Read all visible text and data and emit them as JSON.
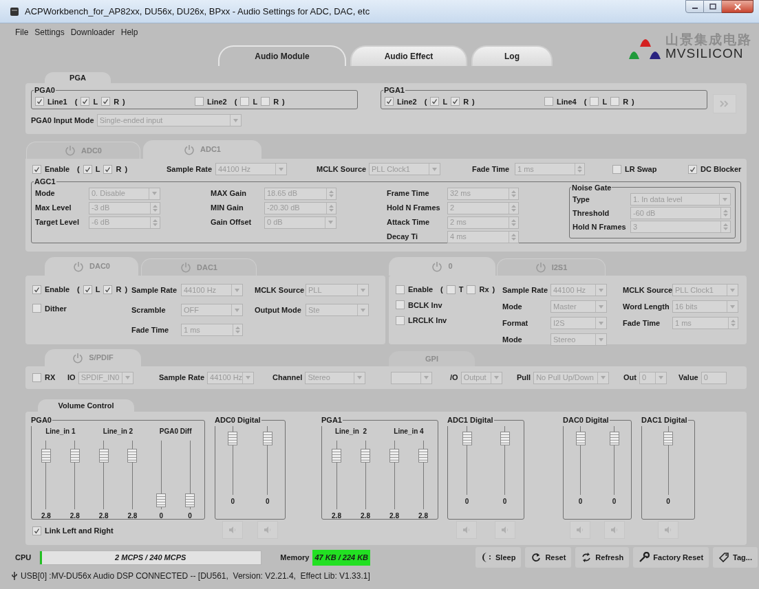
{
  "window": {
    "title": "ACPWorkbench_for_AP82xx, DU56x, DU26x, BPxx - Audio Settings for ADC, DAC, etc"
  },
  "menu": [
    {
      "label": "File"
    },
    {
      "label": "Settings"
    },
    {
      "label": "Downloader"
    },
    {
      "label": "Help"
    }
  ],
  "main_tabs": [
    {
      "label": "Audio Module",
      "selected": true
    },
    {
      "label": "Audio Effect",
      "selected": false
    },
    {
      "label": "Log",
      "selected": false
    }
  ],
  "logo": {
    "name_cn": "山景集成电路",
    "name_en": "MVSILICON"
  },
  "pga": {
    "tab": "PGA",
    "groups": [
      {
        "title": "PGA0",
        "lines": [
          {
            "label": "Line1",
            "checked": true,
            "open": "(",
            "close": ")",
            "channels": [
              {
                "label": "L",
                "checked": true
              },
              {
                "label": "R",
                "checked": true
              }
            ]
          },
          {
            "label": "Line2",
            "checked": false,
            "open": "(",
            "close": ")",
            "channels": [
              {
                "label": "L",
                "checked": false
              },
              {
                "label": "R",
                "checked": false
              }
            ]
          }
        ]
      },
      {
        "title": "PGA1",
        "lines": [
          {
            "label": "Line2",
            "checked": true,
            "open": "(",
            "close": ")",
            "channels": [
              {
                "label": "L",
                "checked": true
              },
              {
                "label": "R",
                "checked": true
              }
            ]
          },
          {
            "label": "Line4",
            "checked": false,
            "open": "(",
            "close": ")",
            "channels": [
              {
                "label": "L",
                "checked": false
              },
              {
                "label": "R",
                "checked": false
              }
            ]
          }
        ]
      }
    ],
    "input_mode": {
      "kind": "combo",
      "label": "PGA0 Input Mode",
      "value": "Single-ended input"
    }
  },
  "adc": {
    "tabs": [
      {
        "label": "ADC0",
        "selected": false
      },
      {
        "label": "ADC1",
        "selected": true
      }
    ],
    "top": [
      {
        "kind": "enable",
        "label": "Enable",
        "checked": true,
        "open": "(",
        "close": ")",
        "channels": [
          {
            "label": "L",
            "checked": true
          },
          {
            "label": "R",
            "checked": true
          }
        ]
      },
      {
        "kind": "combo",
        "label": "Sample Rate",
        "value": "44100 Hz"
      },
      {
        "kind": "combo",
        "label": "MCLK Source",
        "value": "PLL Clock1"
      },
      {
        "kind": "spin",
        "label": "Fade Time",
        "value": "1 ms"
      },
      {
        "kind": "check",
        "label": "LR Swap",
        "checked": false
      },
      {
        "kind": "check",
        "label": "DC Blocker",
        "checked": true
      }
    ],
    "agc": {
      "title": "AGC1",
      "columns": [
        [
          {
            "kind": "combo",
            "label": "Mode",
            "value": "0. Disable"
          },
          {
            "kind": "spin",
            "label": "Max Level",
            "value": "-3 dB"
          },
          {
            "kind": "spin",
            "label": "Target Level",
            "value": "-6 dB"
          }
        ],
        [
          {
            "kind": "spin",
            "label": "MAX Gain",
            "value": "18.65 dB"
          },
          {
            "kind": "spin",
            "label": "MIN Gain",
            "value": "-20.30 dB"
          },
          {
            "kind": "combo",
            "label": "Gain Offset",
            "value": "0 dB"
          }
        ],
        [
          {
            "kind": "spin",
            "label": "Frame Time",
            "value": "32 ms"
          },
          {
            "kind": "spin",
            "label": "Hold N Frames",
            "value": "2"
          },
          {
            "kind": "spin",
            "label": "Attack Time",
            "value": "2 ms"
          },
          {
            "kind": "spin",
            "label": "Decay Ti",
            "value": "4 ms"
          }
        ]
      ],
      "noise_gate": {
        "title": "Noise Gate",
        "fields": [
          {
            "kind": "combo",
            "label": "Type",
            "value": "1. In data level"
          },
          {
            "kind": "spin",
            "label": "Threshold",
            "value": "-60 dB"
          },
          {
            "kind": "spin",
            "label": "Hold N Frames",
            "value": "3"
          }
        ]
      }
    }
  },
  "dac": {
    "tabs": [
      {
        "label": "DAC0",
        "selected": true
      },
      {
        "label": "DAC1",
        "selected": false
      }
    ],
    "columns": [
      [
        {
          "kind": "enable",
          "label": "Enable",
          "checked": true,
          "open": "(",
          "close": ")",
          "channels": [
            {
              "label": "L",
              "checked": true
            },
            {
              "label": "R",
              "checked": true
            }
          ]
        },
        {
          "kind": "check",
          "label": "Dither",
          "checked": false
        }
      ],
      [
        {
          "kind": "combo",
          "label": "Sample Rate",
          "value": "44100 Hz"
        },
        {
          "kind": "combo",
          "label": "Scramble",
          "value": "OFF"
        },
        {
          "kind": "spin",
          "label": "Fade Time",
          "value": "1 ms"
        }
      ],
      [
        {
          "kind": "combo",
          "label": "MCLK Source",
          "value": "PLL"
        },
        {
          "kind": "combo",
          "label": "Output Mode",
          "value": "Ste"
        }
      ]
    ]
  },
  "i2s": {
    "tabs": [
      {
        "label": "0",
        "selected": true
      },
      {
        "label": "I2S1",
        "selected": false
      }
    ],
    "columns": [
      [
        {
          "kind": "enable",
          "label": "Enable",
          "checked": false,
          "open": "(",
          "close": ")",
          "channels": [
            {
              "label": "T",
              "checked": false
            },
            {
              "label": "Rx",
              "checked": false
            }
          ]
        },
        {
          "kind": "check",
          "label": "BCLK Inv",
          "checked": false
        },
        {
          "kind": "check",
          "label": "LRCLK Inv",
          "checked": false
        }
      ],
      [
        {
          "kind": "combo",
          "label": "Sample Rate",
          "value": "44100 Hz"
        },
        {
          "kind": "combo",
          "label": "Mode",
          "value": "Master"
        },
        {
          "kind": "combo",
          "label": "Format",
          "value": "I2S"
        },
        {
          "kind": "combo",
          "label": "Mode",
          "value": "Stereo"
        }
      ],
      [
        {
          "kind": "combo",
          "label": "MCLK Source",
          "value": "PLL Clock1"
        },
        {
          "kind": "combo",
          "label": "Word Length",
          "value": "16 bits"
        },
        {
          "kind": "spin",
          "label": "Fade Time",
          "value": "1 ms"
        }
      ]
    ]
  },
  "spdif": {
    "tabs": [
      {
        "label": "S/PDIF",
        "selected": true
      }
    ],
    "gpio_tab": {
      "label": "GPI"
    },
    "items": [
      {
        "kind": "check",
        "label": "RX",
        "checked": false
      },
      {
        "kind": "combo",
        "label": "IO",
        "value": "SPDIF_IN0"
      },
      {
        "kind": "combo",
        "label": "Sample Rate",
        "value": "44100 Hz"
      },
      {
        "kind": "combo",
        "label": "Channel",
        "value": "Stereo"
      },
      {
        "kind": "combo"
      },
      {
        "kind": "combo",
        "label": "/O",
        "value": "Output"
      },
      {
        "kind": "combo",
        "label": "Pull",
        "value": "No Pull Up/Down"
      },
      {
        "kind": "combo",
        "label": "Out",
        "value": "0"
      },
      {
        "kind": "text",
        "label": "Value",
        "value": "0"
      }
    ]
  },
  "volume": {
    "tab": "Volume Control",
    "groups": [
      {
        "title": "PGA0",
        "mute_buttons": false,
        "channels": [
          {
            "label": "Line_in 1",
            "sliders": [
              {
                "level": 0.85,
                "value": "2.8"
              },
              {
                "level": 0.85,
                "value": "2.8"
              }
            ]
          },
          {
            "label": "Line_in 2",
            "sliders": [
              {
                "level": 0.85,
                "value": "2.8"
              },
              {
                "level": 0.85,
                "value": "2.8"
              }
            ]
          },
          {
            "label": "PGA0 Diff",
            "sliders": [
              {
                "level": 0.03,
                "value": "0"
              },
              {
                "level": 0.03,
                "value": "0"
              }
            ]
          }
        ]
      },
      {
        "title": "ADC0 Digital",
        "mute_buttons": true,
        "channels": [
          {
            "sliders": [
              {
                "level": 0.9,
                "value": "0"
              },
              {
                "level": 0.9,
                "value": "0"
              }
            ]
          }
        ]
      },
      {
        "title": "PGA1",
        "mute_buttons": false,
        "channels": [
          {
            "label": "Line_in  2",
            "sliders": [
              {
                "level": 0.85,
                "value": "2.8"
              },
              {
                "level": 0.85,
                "value": "2.8"
              }
            ]
          },
          {
            "label": "Line_in 4",
            "sliders": [
              {
                "level": 0.85,
                "value": "2.8"
              },
              {
                "level": 0.85,
                "value": "2.8"
              }
            ]
          }
        ]
      },
      {
        "title": "ADC1 Digital",
        "mute_buttons": true,
        "channels": [
          {
            "sliders": [
              {
                "level": 0.9,
                "value": "0"
              },
              {
                "level": 0.9,
                "value": "0"
              }
            ]
          }
        ]
      },
      {
        "title": "DAC0 Digital",
        "mute_buttons": true,
        "channels": [
          {
            "sliders": [
              {
                "level": 0.9,
                "value": "0"
              },
              {
                "level": 0.9,
                "value": "0"
              }
            ]
          }
        ]
      },
      {
        "title": "DAC1 Digital",
        "mute_buttons": true,
        "channels": [
          {
            "sliders": [
              {
                "level": 0.9,
                "value": "0"
              }
            ]
          }
        ]
      }
    ],
    "link": {
      "label": "Link Left and Right",
      "checked": true
    }
  },
  "cpu": {
    "label": "CPU",
    "level": 0.01,
    "reading": "2 MCPS / 240 MCPS"
  },
  "memory": {
    "label": "Memory",
    "reading": "47 KB / 224 KB"
  },
  "buttons": [
    {
      "kind": "sleep",
      "label": "Sleep"
    },
    {
      "kind": "reset",
      "label": "Reset"
    },
    {
      "kind": "refresh",
      "label": "Refresh"
    },
    {
      "kind": "factory_reset",
      "label": "Factory Reset"
    },
    {
      "kind": "tag",
      "label": "Tag..."
    }
  ],
  "status_bar": {
    "text": "USB[0] :MV-DU56x Audio DSP CONNECTED -- [DU561,  Version: V2.21.4,  Effect Lib: V1.33.1]"
  }
}
